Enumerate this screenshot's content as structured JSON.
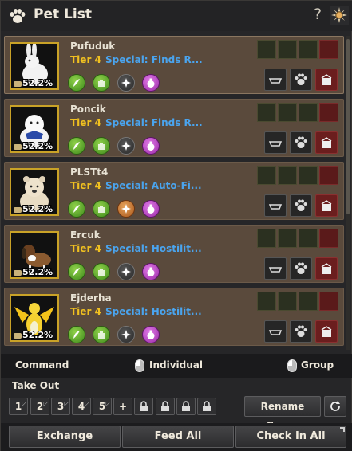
{
  "window": {
    "title": "Pet List",
    "help_label": "?"
  },
  "pets": [
    {
      "name": "Pufuduk",
      "level": "52.2%",
      "tier": "Tier 4",
      "special": "Special: Finds R...",
      "portrait": "white-rabbit"
    },
    {
      "name": "Poncik",
      "level": "52.2%",
      "tier": "Tier 4",
      "special": "Special: Finds R...",
      "portrait": "white-seal"
    },
    {
      "name": "PLSTt4",
      "level": "52.2%",
      "tier": "Tier 4",
      "special": "Special: Auto-Fi...",
      "portrait": "polar-bear"
    },
    {
      "name": "Ercuk",
      "level": "52.2%",
      "tier": "Tier 4",
      "special": "Special: Hostilit...",
      "portrait": "beagle-dog"
    },
    {
      "name": "Ejderha",
      "level": "52.2%",
      "tier": "Tier 4",
      "special": "Special: Hostilit...",
      "portrait": "golden-dragon"
    }
  ],
  "command": {
    "label": "Command",
    "individual_label": "Individual",
    "group_label": "Group"
  },
  "take_out": {
    "label": "Take Out",
    "slots": [
      "1",
      "2",
      "3",
      "4",
      "5"
    ],
    "add_label": "+",
    "rename_label": "Rename Group"
  },
  "footer": {
    "exchange_label": "Exchange",
    "feed_all_label": "Feed All",
    "check_in_all_label": "Check In All"
  },
  "colors": {
    "tier": "#f0c020",
    "special": "#4aa4ee",
    "card_bg": "#5a4a3c",
    "portrait_border": "#c9a227"
  }
}
